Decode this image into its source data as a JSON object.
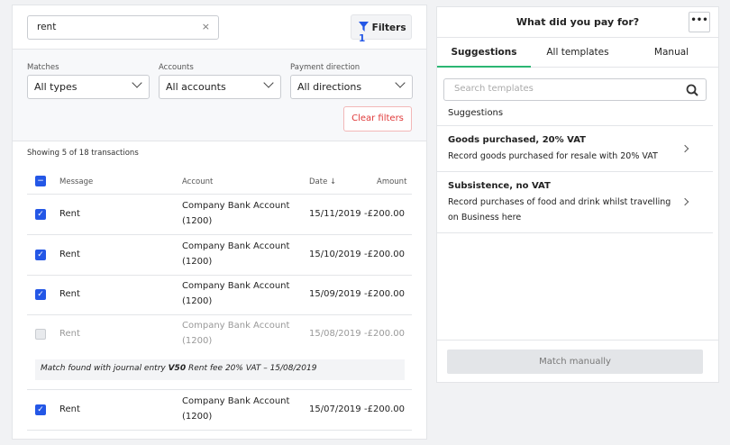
{
  "search": {
    "value": "rent",
    "clear_icon": "×"
  },
  "filters_button": {
    "label": "Filters",
    "count": "1"
  },
  "filter_fields": [
    {
      "label": "Matches",
      "value": "All types"
    },
    {
      "label": "Accounts",
      "value": "All accounts"
    },
    {
      "label": "Payment direction",
      "value": "All directions"
    }
  ],
  "clear_filters": "Clear filters",
  "showing": "Showing 5 of 18 transactions",
  "table": {
    "headers": {
      "message": "Message",
      "account": "Account",
      "date": "Date ↓",
      "amount": "Amount"
    },
    "rows": [
      {
        "checked": true,
        "message": "Rent",
        "account": "Company Bank Account",
        "code": "(1200)",
        "date": "15/11/2019",
        "amount": "-£200.00"
      },
      {
        "checked": true,
        "message": "Rent",
        "account": "Company Bank Account",
        "code": "(1200)",
        "date": "15/10/2019",
        "amount": "-£200.00"
      },
      {
        "checked": true,
        "message": "Rent",
        "account": "Company Bank Account",
        "code": "(1200)",
        "date": "15/09/2019",
        "amount": "-£200.00"
      },
      {
        "checked": false,
        "message": "Rent",
        "account": "Company Bank Account",
        "code": "(1200)",
        "date": "15/08/2019",
        "amount": "-£200.00"
      },
      {
        "checked": true,
        "message": "Rent",
        "account": "Company Bank Account",
        "code": "(1200)",
        "date": "15/07/2019",
        "amount": "-£200.00"
      }
    ],
    "match_note": {
      "prefix": "Match found with journal entry ",
      "ref": "V50",
      "suffix": " Rent fee 20% VAT – 15/08/2019"
    }
  },
  "panel": {
    "title": "What did you pay for?",
    "more": "•••",
    "tabs": [
      "Suggestions",
      "All templates",
      "Manual"
    ],
    "active_tab": "Suggestions",
    "search_placeholder": "Search templates",
    "section_label": "Suggestions",
    "items": [
      {
        "title": "Goods purchased, 20% VAT",
        "desc": "Record goods purchased for resale with 20% VAT"
      },
      {
        "title": "Subsistence, no VAT",
        "desc": "Record purchases of food and drink whilst travelling on Business here"
      }
    ],
    "match_manually": "Match manually"
  },
  "colors": {
    "accent": "#2457e6",
    "danger": "#e03a3a",
    "tab_active": "#2bb673"
  }
}
